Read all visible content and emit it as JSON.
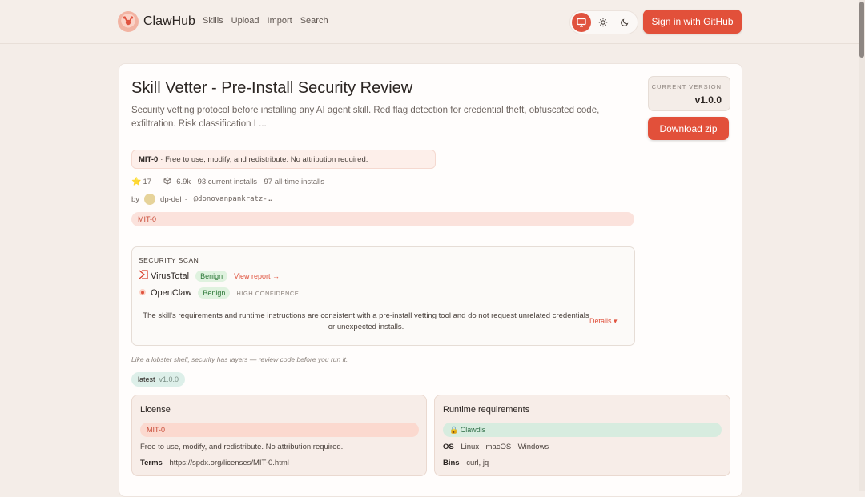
{
  "header": {
    "brand": "ClawHub",
    "nav": [
      "Skills",
      "Upload",
      "Import",
      "Search"
    ],
    "signin": "Sign in  with GitHub",
    "accent": "#e2503a"
  },
  "skill": {
    "title": "Skill Vetter - Pre-Install Security Review",
    "description": "Security vetting protocol before installing any AI agent skill. Red flag detection for credential theft, obfuscated code, exfiltration. Risk classification L...",
    "version_label": "CURRENT VERSION",
    "version": "v1.0.0",
    "download": "Download zip",
    "license_name": "MIT-0",
    "license_summary": "· Free to use, modify, and redistribute. No attribution required.",
    "stars": "17",
    "installs": "6.9k · 93 current installs · 97 all-time installs",
    "by": "by",
    "author": "dp-del",
    "handle": "@donovanpankratz-…",
    "tag": "MIT-0"
  },
  "scan": {
    "label": "SECURITY SCAN",
    "virustotal": "VirusTotal",
    "virustotal_status": "Benign",
    "view_report": "View report →",
    "openclaw": "OpenClaw",
    "openclaw_status": "Benign",
    "confidence": "HIGH CONFIDENCE",
    "summary": "The skill's requirements and runtime instructions are consistent with a pre-install vetting tool and do not request unrelated credentials or unexpected installs.",
    "details": "Details ▾"
  },
  "quote": "Like a lobster shell, security has layers — review code before you run it.",
  "latest": {
    "label": "latest",
    "version": "v1.0.0"
  },
  "license_panel": {
    "title": "License",
    "pill": "MIT-0",
    "text": "Free to use, modify, and redistribute. No attribution required.",
    "terms_label": "Terms",
    "terms_url": "https://spdx.org/licenses/MIT-0.html"
  },
  "runtime_panel": {
    "title": "Runtime requirements",
    "pill": "🔒 Clawdis",
    "os_label": "OS",
    "os_value": "Linux · macOS · Windows",
    "bins_label": "Bins",
    "bins_value": "curl, jq"
  }
}
